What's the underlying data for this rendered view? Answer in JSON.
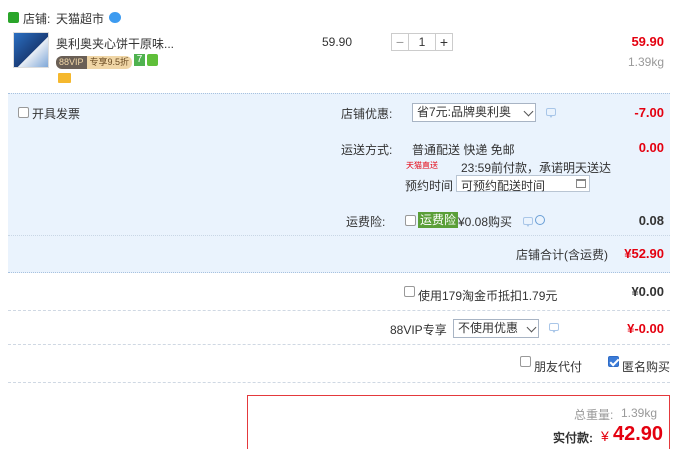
{
  "shop": {
    "label": "店铺:",
    "name": "天猫超市"
  },
  "item": {
    "title": "奥利奥夹心饼干原味...",
    "vip_badge": "88VIP",
    "vip_discount": "专享9.5折",
    "tag_7": "7",
    "unit_price": "59.90",
    "quantity": "1",
    "total": "59.90",
    "weight": "1.39kg"
  },
  "invoice": {
    "label": "开具发票"
  },
  "discount": {
    "label": "店铺优惠:",
    "selected": "省7元:品牌奥利奥",
    "amount": "-7.00"
  },
  "shipping": {
    "label": "运送方式:",
    "method": "普通配送 快递 免邮",
    "tmall_badge": "天猫直送",
    "promise": "23:59前付款，承诺明天送达",
    "appoint_label": "预约时间",
    "appoint_placeholder": "可预约配送时间",
    "amount": "0.00"
  },
  "insurance": {
    "label": "运费险:",
    "tag": "运费险",
    "text": "¥0.08购买",
    "amount": "0.08"
  },
  "shop_total": {
    "label": "店铺合计(含运费)",
    "value": "¥52.90"
  },
  "coins": {
    "label": "使用179淘金币抵扣1.79元",
    "amount": "¥0.00"
  },
  "vip88": {
    "label": "88VIP专享",
    "selected": "不使用优惠",
    "amount": "¥-0.00"
  },
  "options": {
    "friend_pay": "朋友代付",
    "anonymous": "匿名购买"
  },
  "summary": {
    "weight_label": "总重量:",
    "weight": "1.39kg",
    "pay_label": "实付款:",
    "currency": "¥",
    "pay_value": "42.90"
  },
  "colors": {
    "accent_red": "#e4000f",
    "panel_blue": "#eaf3fd",
    "summary_border": "#e4393c"
  }
}
